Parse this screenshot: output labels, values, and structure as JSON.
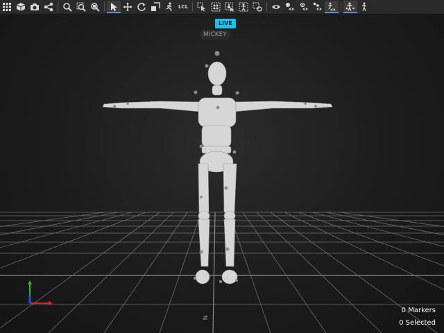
{
  "toolbar": {
    "groups": [
      [
        "grid-icon",
        "cube-icon",
        "camera-icon",
        "nodes-icon"
      ],
      [
        "zoom-icon",
        "zoom-area-icon",
        "zoom-fit-icon"
      ],
      [
        "select-arrow-icon",
        "move-icon",
        "rotate-icon",
        "scale-icon",
        "run-figure-icon",
        "local-space-label"
      ],
      [
        "marker-select-icon",
        "marker-add-icon",
        "marker-assign-icon",
        "skeleton-icon",
        "marker-remove-icon"
      ],
      [
        "eye-icon",
        "visibility-markers-icon",
        "visibility-rigid-icon",
        "visibility-links-icon",
        "visibility-skeleton-icon"
      ],
      [
        "actor-icon",
        "bone-figure-icon"
      ]
    ],
    "active": [
      "select-arrow-icon",
      "visibility-skeleton-icon",
      "actor-icon"
    ],
    "local_label": "LCL"
  },
  "viewport": {
    "live_badge": "LIVE",
    "actor_name": "MICKEY",
    "compass_label": "N",
    "markers_status": "0 Markers",
    "selected_status": "0 Selected"
  },
  "colors": {
    "live_badge": "#18c2ee",
    "grid_line": "#8a8a8a",
    "axis_x": "#e02020",
    "axis_y": "#20c020",
    "axis_z": "#2050ff"
  }
}
